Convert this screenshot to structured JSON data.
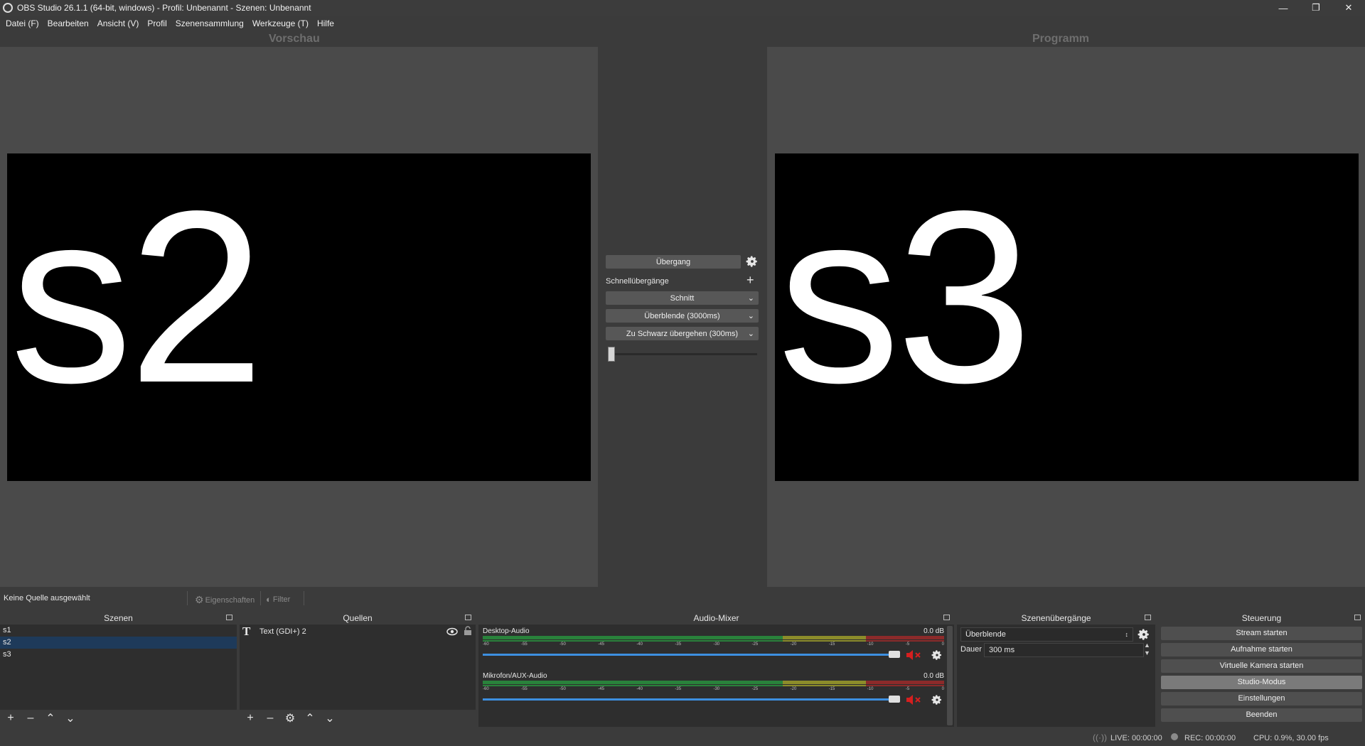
{
  "window": {
    "title": "OBS Studio 26.1.1 (64-bit, windows) - Profil: Unbenannt - Szenen: Unbenannt"
  },
  "menu": [
    "Datei (F)",
    "Bearbeiten",
    "Ansicht (V)",
    "Profil",
    "Szenensammlung",
    "Werkzeuge (T)",
    "Hilfe"
  ],
  "preview": {
    "label": "Vorschau",
    "content": "s2"
  },
  "program": {
    "label": "Programm",
    "content": "s3"
  },
  "transitions": {
    "transition_button": "Übergang",
    "quick_label": "Schnellübergänge",
    "quick": [
      "Schnitt",
      "Überblende (3000ms)",
      "Zu Schwarz übergehen (300ms)"
    ],
    "slider_position": 0
  },
  "status_row": {
    "no_source": "Keine Quelle ausgewählt",
    "properties": "Eigenschaften",
    "filters": "Filter"
  },
  "docks": {
    "scenes": {
      "title": "Szenen",
      "items": [
        "s1",
        "s2",
        "s3"
      ],
      "selected": "s2"
    },
    "sources": {
      "title": "Quellen",
      "items": [
        "Text (GDI+) 2"
      ]
    },
    "mixer": {
      "title": "Audio-Mixer",
      "ticks": [
        "-60",
        "-55",
        "-50",
        "-45",
        "-40",
        "-35",
        "-30",
        "-25",
        "-20",
        "-15",
        "-10",
        "-5",
        "0"
      ],
      "channels": [
        {
          "name": "Desktop-Audio",
          "db": "0.0 dB",
          "volume": 1.0,
          "muted": true
        },
        {
          "name": "Mikrofon/AUX-Audio",
          "db": "0.0 dB",
          "volume": 1.0,
          "muted": true
        }
      ]
    },
    "scene_transitions": {
      "title": "Szenenübergänge",
      "selected": "Überblende",
      "duration_label": "Dauer",
      "duration_value": "300 ms"
    },
    "controls": {
      "title": "Steuerung",
      "buttons": [
        "Stream starten",
        "Aufnahme starten",
        "Virtuelle Kamera starten",
        "Studio-Modus",
        "Einstellungen",
        "Beenden"
      ],
      "active": "Studio-Modus"
    }
  },
  "statusbar": {
    "live": "LIVE: 00:00:00",
    "rec": "REC: 00:00:00",
    "cpu": "CPU: 0.9%, 30.00 fps"
  },
  "colors": {
    "mute_red": "#d61f1f",
    "volume_blue": "#3d8fe0",
    "selection": "#1e3a5a"
  }
}
